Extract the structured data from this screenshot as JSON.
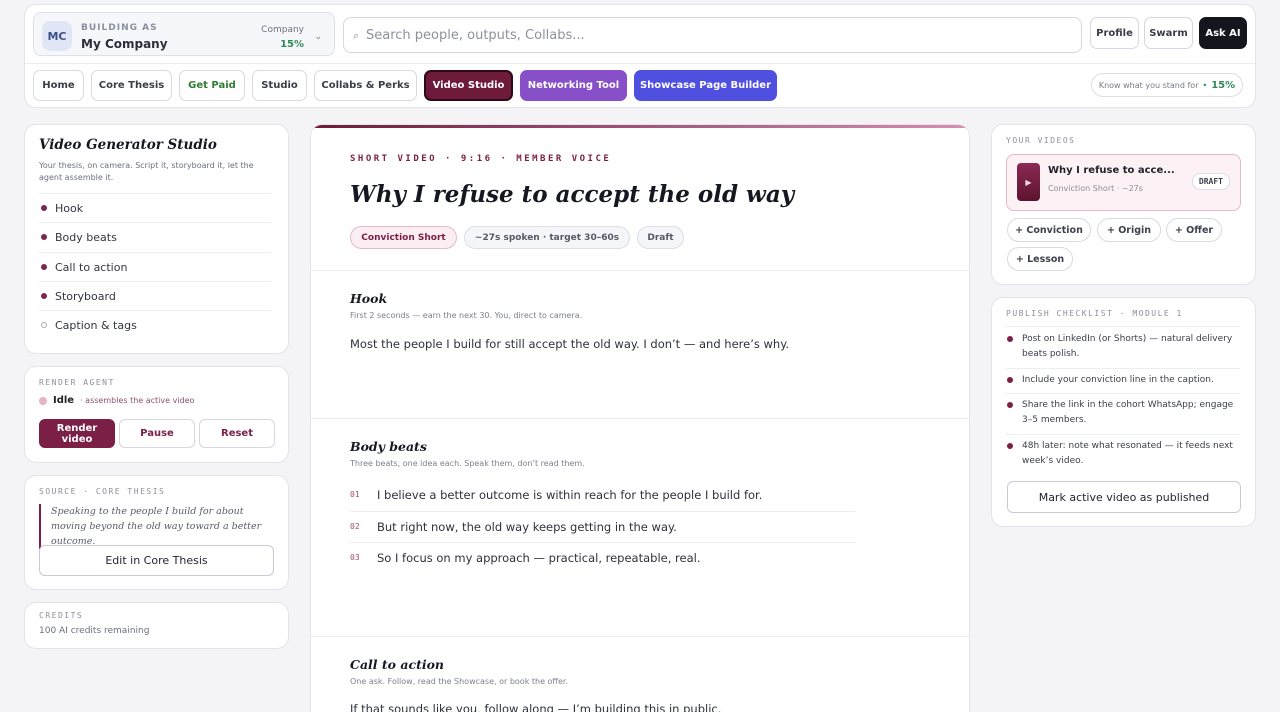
{
  "workspace": {
    "avatar": "MC",
    "kicker": "BUILDING AS",
    "name": "My Company",
    "company_label": "Company",
    "company_pct": "15%",
    "chevron": "⌄"
  },
  "search": {
    "icon": "⌕",
    "placeholder": "Search people, outputs, Collabs..."
  },
  "header_buttons": {
    "profile": "Profile",
    "swarm": "Swarm",
    "ask_ai": "Ask AI"
  },
  "nav": [
    {
      "label": "Home"
    },
    {
      "label": "Core Thesis"
    },
    {
      "label": "Get Paid"
    },
    {
      "label": "Studio"
    },
    {
      "label": "Collabs & Perks"
    },
    {
      "label": "Video Studio"
    },
    {
      "label": "Networking Tool"
    },
    {
      "label": "Showcase Page Builder"
    }
  ],
  "stand": {
    "label": "Know what you stand for",
    "dot": "•",
    "pct": "15%"
  },
  "video_generator": {
    "title": "Video Generator Studio",
    "subtitle": "Your thesis, on camera. Script it, storyboard it, let the agent assemble it.",
    "steps": [
      {
        "label": "Hook",
        "done": true
      },
      {
        "label": "Body beats",
        "done": true
      },
      {
        "label": "Call to action",
        "done": true
      },
      {
        "label": "Storyboard",
        "done": true
      },
      {
        "label": "Caption & tags",
        "done": false
      }
    ]
  },
  "render_agent": {
    "title": "RENDER AGENT",
    "status": "Idle",
    "status_desc": "· assembles the active video",
    "buttons": {
      "render": "Render video",
      "pause": "Pause",
      "reset": "Reset"
    }
  },
  "source": {
    "title": "SOURCE · CORE THESIS",
    "quote": "Speaking to the people I build for about moving beyond the old way toward a better outcome.",
    "edit_button": "Edit in Core Thesis"
  },
  "credits": {
    "title": "CREDITS",
    "text": "100 AI credits remaining"
  },
  "main": {
    "kicker": "SHORT VIDEO · 9:16 · MEMBER VOICE",
    "title": "Why I refuse to accept the old way",
    "pills": [
      "Conviction Short",
      "~27s spoken · target 30–60s",
      "Draft"
    ],
    "hook": {
      "title": "Hook",
      "subtitle": "First 2 seconds — earn the next 30. You, direct to camera.",
      "text": "Most the people I build for still accept the old way. I don’t — and here’s why."
    },
    "body": {
      "title": "Body beats",
      "subtitle": "Three beats, one idea each. Speak them, don’t read them.",
      "beats": [
        {
          "num": "01",
          "text": "I believe a better outcome is within reach for the people I build for."
        },
        {
          "num": "02",
          "text": "But right now, the old way keeps getting in the way."
        },
        {
          "num": "03",
          "text": "So I focus on my approach — practical, repeatable, real."
        }
      ]
    },
    "cta": {
      "title": "Call to action",
      "subtitle": "One ask. Follow, read the Showcase, or book the offer.",
      "text": "If that sounds like you, follow along — I’m building this in public."
    }
  },
  "your_videos": {
    "title": "YOUR VIDEOS",
    "item": {
      "play": "▶",
      "name": "Why I refuse to acce...",
      "meta": "Conviction Short · ~27s",
      "badge": "DRAFT"
    },
    "add": [
      "+ Conviction",
      "+ Origin",
      "+ Offer",
      "+ Lesson"
    ]
  },
  "checklist": {
    "title": "PUBLISH CHECKLIST · MODULE 1",
    "items": [
      "Post on LinkedIn (or Shorts) — natural delivery beats polish.",
      "Include your conviction line in the caption.",
      "Share the link in the cohort WhatsApp; engage 3–5 members.",
      "48h later: note what resonated — it feeds next week’s video."
    ],
    "button": "Mark active video as published"
  }
}
